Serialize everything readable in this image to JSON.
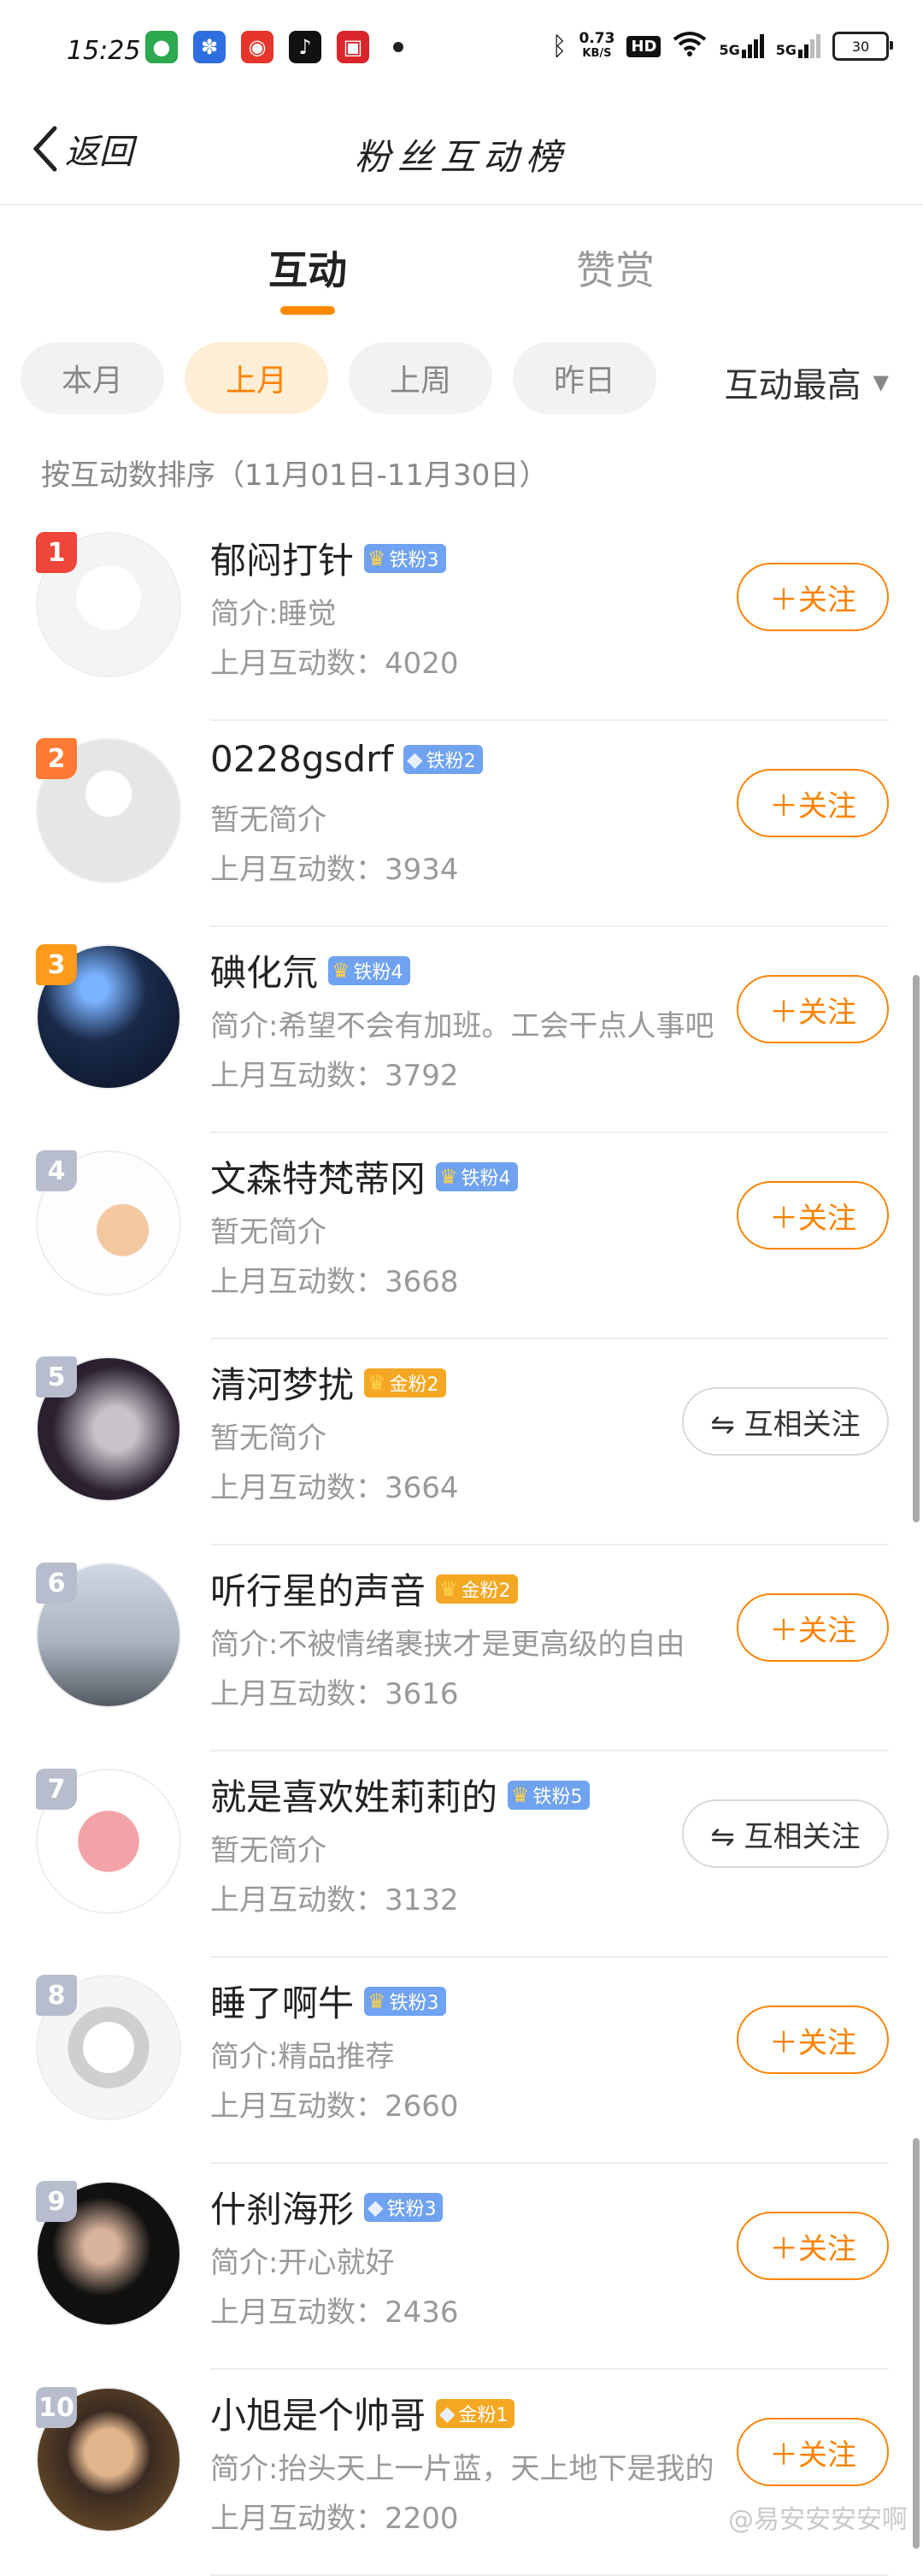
{
  "status_bar": {
    "time": "15:25",
    "net_speed": "0.73",
    "net_unit": "KB/S",
    "hd": "HD",
    "signal1": "5G",
    "signal2": "5G",
    "battery": "30"
  },
  "nav": {
    "back_label": "返回",
    "title": "粉丝互动榜"
  },
  "tabs": [
    {
      "label": "互动",
      "active": true
    },
    {
      "label": "赞赏",
      "active": false
    }
  ],
  "filters": [
    {
      "label": "本月",
      "active": false
    },
    {
      "label": "上月",
      "active": true
    },
    {
      "label": "上周",
      "active": false
    },
    {
      "label": "昨日",
      "active": false
    }
  ],
  "sort": {
    "label": "互动最高"
  },
  "subtitle": "按互动数排序（11月01日-11月30日）",
  "count_label": "上月互动数：",
  "colors": {
    "accent": "#ff8200",
    "rank1": "#f0453a",
    "rank2": "#ff7a33",
    "rank3": "#ff9a1a",
    "rank_other": "#b7bdcc",
    "iron": "#6fa2f0",
    "gold": "#f4a722"
  },
  "users": [
    {
      "rank": "1",
      "name": "郁闷打针",
      "badge": "铁粉3",
      "badge_type": "iron",
      "crown": true,
      "bio": "简介:睡觉",
      "count": "4020",
      "action": "＋关注",
      "action_type": "follow"
    },
    {
      "rank": "2",
      "name": "0228gsdrf",
      "badge": "铁粉2",
      "badge_type": "iron",
      "crown": false,
      "bio": "暂无简介",
      "count": "3934",
      "action": "＋关注",
      "action_type": "follow"
    },
    {
      "rank": "3",
      "name": "碘化氘",
      "badge": "铁粉4",
      "badge_type": "iron",
      "crown": true,
      "bio": "简介:希望不会有加班。工会干点人事吧",
      "count": "3792",
      "action": "＋关注",
      "action_type": "follow"
    },
    {
      "rank": "4",
      "name": "文森特梵蒂冈",
      "badge": "铁粉4",
      "badge_type": "iron",
      "crown": true,
      "bio": "暂无简介",
      "count": "3668",
      "action": "＋关注",
      "action_type": "follow"
    },
    {
      "rank": "5",
      "name": "清河梦扰",
      "badge": "金粉2",
      "badge_type": "gold",
      "crown": true,
      "bio": "暂无简介",
      "count": "3664",
      "action": "⇋ 互相关注",
      "action_type": "mutual"
    },
    {
      "rank": "6",
      "name": "听行星的声音",
      "badge": "金粉2",
      "badge_type": "gold",
      "crown": true,
      "bio": "简介:不被情绪裹挟才是更高级的自由",
      "count": "3616",
      "action": "＋关注",
      "action_type": "follow"
    },
    {
      "rank": "7",
      "name": "就是喜欢姓莉莉的",
      "badge": "铁粉5",
      "badge_type": "iron",
      "crown": true,
      "bio": "暂无简介",
      "count": "3132",
      "action": "⇋ 互相关注",
      "action_type": "mutual"
    },
    {
      "rank": "8",
      "name": "睡了啊牛",
      "badge": "铁粉3",
      "badge_type": "iron",
      "crown": true,
      "bio": "简介:精品推荐",
      "count": "2660",
      "action": "＋关注",
      "action_type": "follow"
    },
    {
      "rank": "9",
      "name": "什刹海形",
      "badge": "铁粉3",
      "badge_type": "iron",
      "crown": false,
      "bio": "简介:开心就好",
      "count": "2436",
      "action": "＋关注",
      "action_type": "follow"
    },
    {
      "rank": "10",
      "name": "小旭是个帅哥",
      "badge": "金粉1",
      "badge_type": "gold",
      "crown": false,
      "bio": "简介:抬头天上一片蓝，天上地下是我的",
      "count": "2200",
      "action": "＋关注",
      "action_type": "follow"
    }
  ],
  "watermark": "@易安安安安啊"
}
